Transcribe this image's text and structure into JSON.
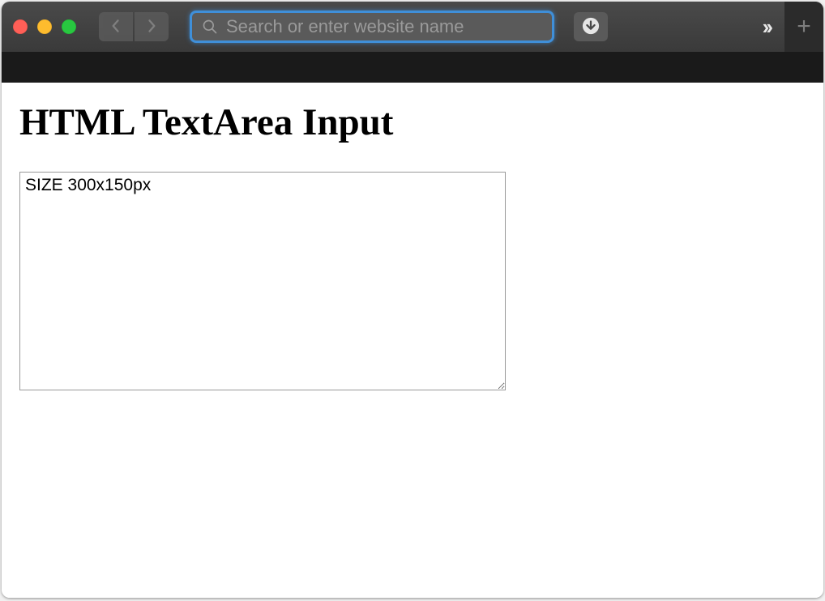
{
  "browser": {
    "address_placeholder": "Search or enter website name",
    "address_value": ""
  },
  "page": {
    "heading": "HTML TextArea Input",
    "textarea_value": "SIZE 300x150px"
  }
}
